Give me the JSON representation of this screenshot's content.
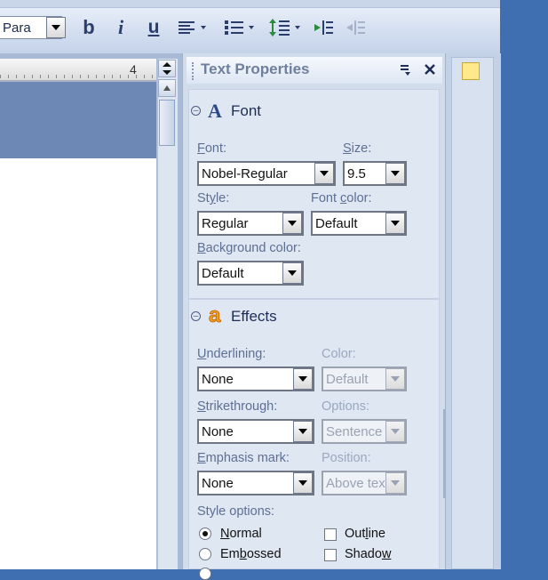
{
  "toolbar": {
    "style_value": "Para",
    "icons": [
      "bold-icon",
      "italic-icon",
      "underline-icon",
      "align-left-icon",
      "bullet-list-icon",
      "line-spacing-icon",
      "increase-indent-icon",
      "decrease-indent-icon"
    ],
    "bold": "b",
    "italic": "i",
    "underline": "u"
  },
  "ruler": {
    "mark": "4"
  },
  "panel": {
    "title": "Text Properties",
    "font_section": {
      "header": "Font",
      "font_label": "Font:",
      "font_value": "Nobel-Regular",
      "size_label": "Size:",
      "size_value": "9.5",
      "style_label": "Style:",
      "style_value": "Regular",
      "font_color_label": "Font color:",
      "font_color_value": "Default",
      "background_color_label": "Background color:",
      "background_color_value": "Default"
    },
    "effects_section": {
      "header": "Effects",
      "underlining_label": "Underlining:",
      "underlining_value": "None",
      "color_label": "Color:",
      "color_value": "Default",
      "strikethrough_label": "Strikethrough:",
      "strikethrough_value": "None",
      "options_label": "Options:",
      "options_value": "Sentence",
      "emphasis_label": "Emphasis mark:",
      "emphasis_value": "None",
      "position_label": "Position:",
      "position_value": "Above tex",
      "style_options_label": "Style options:",
      "radio_normal": "Normal",
      "radio_embossed": "Embossed",
      "check_outline": "Outline",
      "check_shadow": "Shadow"
    }
  },
  "colors": {
    "accent": "#3f6fb0",
    "panel": "#d2ddec",
    "label": "#5d6f95"
  }
}
